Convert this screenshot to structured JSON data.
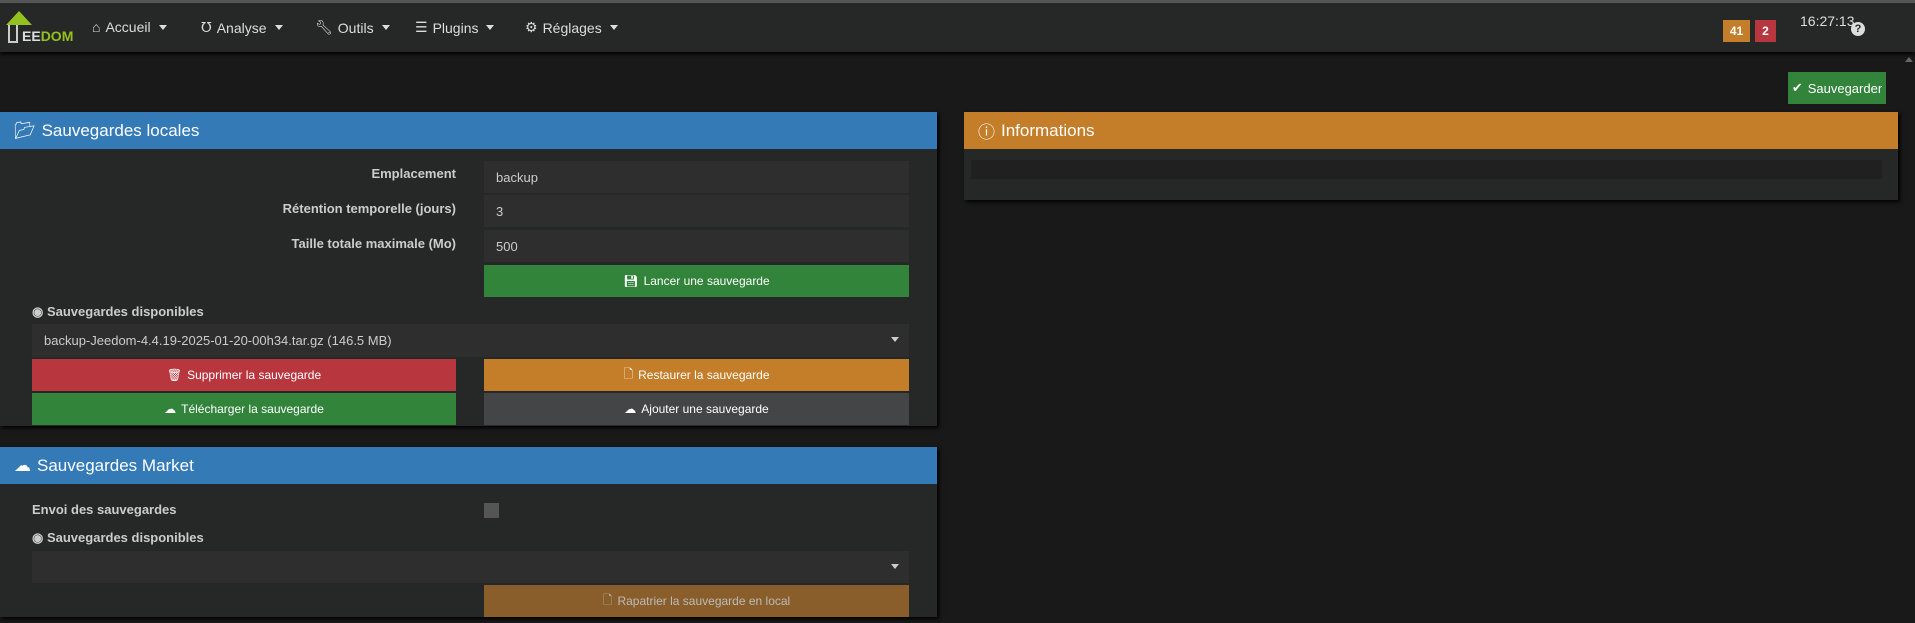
{
  "nav": {
    "logo": "EEDOM",
    "menus": [
      "Accueil",
      "Analyse",
      "Outils",
      "Plugins",
      "Réglages"
    ],
    "badge_warning": "41",
    "badge_danger": "2",
    "time": "16:27:13"
  },
  "save_button": "Sauvegarder",
  "local": {
    "title": "Sauvegardes locales",
    "location_label": "Emplacement",
    "location_value": "backup",
    "retention_label": "Rétention temporelle (jours)",
    "retention_value": "3",
    "maxsize_label": "Taille totale maximale (Mo)",
    "maxsize_value": "500",
    "launch": "Lancer une sauvegarde",
    "available_label": "Sauvegardes disponibles",
    "selected_backup": "backup-Jeedom-4.4.19-2025-01-20-00h34.tar.gz (146.5 MB)",
    "delete": "Supprimer la sauvegarde",
    "restore": "Restaurer la sauvegarde",
    "download": "Télécharger la sauvegarde",
    "add": "Ajouter une sauvegarde"
  },
  "market": {
    "title": "Sauvegardes Market",
    "send_label": "Envoi des sauvegardes",
    "send_checked": false,
    "available_label": "Sauvegardes disponibles",
    "selected_backup": "",
    "fetch": "Rapatrier la sauvegarde en local"
  },
  "info": {
    "title": "Informations",
    "content": ""
  },
  "colors": {
    "blue": "#337ab7",
    "orange": "#c47d29",
    "green": "#32843b",
    "red": "#b8373f",
    "grey": "#444546"
  }
}
